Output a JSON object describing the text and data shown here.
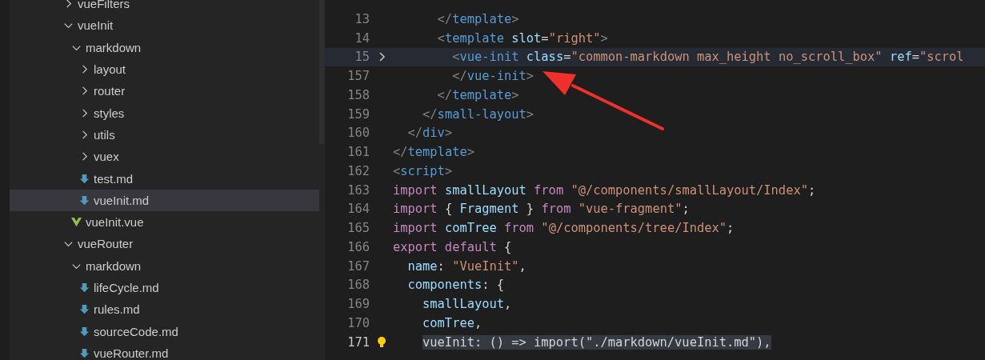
{
  "explorer": {
    "items": [
      {
        "name": "vueFilters",
        "kind": "folder",
        "expanded": false,
        "selected": false
      },
      {
        "name": "vueInit",
        "kind": "folder",
        "expanded": true,
        "selected": false,
        "children": [
          {
            "name": "markdown",
            "kind": "folder",
            "expanded": true,
            "selected": false,
            "children": [
              {
                "name": "layout",
                "kind": "folder",
                "expanded": false,
                "selected": false
              },
              {
                "name": "router",
                "kind": "folder",
                "expanded": false,
                "selected": false
              },
              {
                "name": "styles",
                "kind": "folder",
                "expanded": false,
                "selected": false
              },
              {
                "name": "utils",
                "kind": "folder",
                "expanded": false,
                "selected": false
              },
              {
                "name": "vuex",
                "kind": "folder",
                "expanded": false,
                "selected": false
              },
              {
                "name": "test.md",
                "kind": "md",
                "selected": false
              },
              {
                "name": "vueInit.md",
                "kind": "md",
                "selected": true
              }
            ]
          },
          {
            "name": "vueInit.vue",
            "kind": "vue",
            "selected": false
          }
        ]
      },
      {
        "name": "vueRouter",
        "kind": "folder",
        "expanded": true,
        "selected": false,
        "children": [
          {
            "name": "markdown",
            "kind": "folder",
            "expanded": true,
            "selected": false,
            "children": [
              {
                "name": "lifeCycle.md",
                "kind": "md",
                "selected": false
              },
              {
                "name": "rules.md",
                "kind": "md",
                "selected": false
              },
              {
                "name": "sourceCode.md",
                "kind": "md",
                "selected": false
              },
              {
                "name": "vueRouter.md",
                "kind": "md",
                "selected": false
              }
            ]
          }
        ]
      }
    ]
  },
  "editor": {
    "lines": [
      {
        "number": "13",
        "folded": false,
        "current": false,
        "lightbulb": false,
        "tokens": [
          {
            "kind": "punct",
            "text": "      </"
          },
          {
            "kind": "tag",
            "text": "template"
          },
          {
            "kind": "punct",
            "text": ">"
          }
        ]
      },
      {
        "number": "14",
        "folded": false,
        "current": false,
        "lightbulb": false,
        "tokens": [
          {
            "kind": "punct",
            "text": "      <"
          },
          {
            "kind": "tag",
            "text": "template"
          },
          {
            "kind": "attr",
            "text": " slot"
          },
          {
            "kind": "plain",
            "text": "="
          },
          {
            "kind": "str",
            "text": "\"right\""
          },
          {
            "kind": "punct",
            "text": ">"
          }
        ]
      },
      {
        "number": "15",
        "folded": true,
        "current": false,
        "lightbulb": false,
        "tokens": [
          {
            "kind": "punct",
            "text": "        <"
          },
          {
            "kind": "tag",
            "text": "vue-init"
          },
          {
            "kind": "attr",
            "text": " class"
          },
          {
            "kind": "plain",
            "text": "="
          },
          {
            "kind": "str",
            "text": "\"common-markdown max_height no_scroll_box\""
          },
          {
            "kind": "attr",
            "text": " ref"
          },
          {
            "kind": "plain",
            "text": "="
          },
          {
            "kind": "str",
            "text": "\"scrol"
          }
        ]
      },
      {
        "number": "157",
        "folded": false,
        "current": false,
        "lightbulb": false,
        "tokens": [
          {
            "kind": "punct",
            "text": "        </"
          },
          {
            "kind": "tag",
            "text": "vue-init"
          },
          {
            "kind": "punct",
            "text": ">"
          }
        ]
      },
      {
        "number": "158",
        "folded": false,
        "current": false,
        "lightbulb": false,
        "tokens": [
          {
            "kind": "punct",
            "text": "      </"
          },
          {
            "kind": "tag",
            "text": "template"
          },
          {
            "kind": "punct",
            "text": ">"
          }
        ]
      },
      {
        "number": "159",
        "folded": false,
        "current": false,
        "lightbulb": false,
        "tokens": [
          {
            "kind": "punct",
            "text": "    </"
          },
          {
            "kind": "tag",
            "text": "small-layout"
          },
          {
            "kind": "punct",
            "text": ">"
          }
        ]
      },
      {
        "number": "160",
        "folded": false,
        "current": false,
        "lightbulb": false,
        "tokens": [
          {
            "kind": "punct",
            "text": "  </"
          },
          {
            "kind": "tag",
            "text": "div"
          },
          {
            "kind": "punct",
            "text": ">"
          }
        ]
      },
      {
        "number": "161",
        "folded": false,
        "current": false,
        "lightbulb": false,
        "tokens": [
          {
            "kind": "punct",
            "text": "</"
          },
          {
            "kind": "tag",
            "text": "template"
          },
          {
            "kind": "punct",
            "text": ">"
          }
        ]
      },
      {
        "number": "162",
        "folded": false,
        "current": false,
        "lightbulb": false,
        "tokens": [
          {
            "kind": "punct",
            "text": "<"
          },
          {
            "kind": "tag",
            "text": "script"
          },
          {
            "kind": "punct",
            "text": ">"
          }
        ]
      },
      {
        "number": "163",
        "folded": false,
        "current": false,
        "lightbulb": false,
        "tokens": [
          {
            "kind": "kw",
            "text": "import"
          },
          {
            "kind": "var",
            "text": " smallLayout"
          },
          {
            "kind": "kw",
            "text": " from"
          },
          {
            "kind": "str",
            "text": " \"@/components/smallLayout/Index\""
          },
          {
            "kind": "plain",
            "text": ";"
          }
        ]
      },
      {
        "number": "164",
        "folded": false,
        "current": false,
        "lightbulb": false,
        "tokens": [
          {
            "kind": "kw",
            "text": "import"
          },
          {
            "kind": "plain",
            "text": " { "
          },
          {
            "kind": "var",
            "text": "Fragment"
          },
          {
            "kind": "plain",
            "text": " }"
          },
          {
            "kind": "kw",
            "text": " from"
          },
          {
            "kind": "str",
            "text": " \"vue-fragment\""
          },
          {
            "kind": "plain",
            "text": ";"
          }
        ]
      },
      {
        "number": "165",
        "folded": false,
        "current": false,
        "lightbulb": false,
        "tokens": [
          {
            "kind": "kw",
            "text": "import"
          },
          {
            "kind": "var",
            "text": " comTree"
          },
          {
            "kind": "kw",
            "text": " from"
          },
          {
            "kind": "str",
            "text": " \"@/components/tree/Index\""
          },
          {
            "kind": "plain",
            "text": ";"
          }
        ]
      },
      {
        "number": "166",
        "folded": false,
        "current": false,
        "lightbulb": false,
        "tokens": [
          {
            "kind": "kw",
            "text": "export default"
          },
          {
            "kind": "plain",
            "text": " {"
          }
        ]
      },
      {
        "number": "167",
        "folded": false,
        "current": false,
        "lightbulb": false,
        "tokens": [
          {
            "kind": "var",
            "text": "  name"
          },
          {
            "kind": "plain",
            "text": ": "
          },
          {
            "kind": "str",
            "text": "\"VueInit\""
          },
          {
            "kind": "plain",
            "text": ","
          }
        ]
      },
      {
        "number": "168",
        "folded": false,
        "current": false,
        "lightbulb": false,
        "tokens": [
          {
            "kind": "var",
            "text": "  components"
          },
          {
            "kind": "plain",
            "text": ": {"
          }
        ]
      },
      {
        "number": "169",
        "folded": false,
        "current": false,
        "lightbulb": false,
        "tokens": [
          {
            "kind": "var",
            "text": "    smallLayout"
          },
          {
            "kind": "plain",
            "text": ","
          }
        ]
      },
      {
        "number": "170",
        "folded": false,
        "current": false,
        "lightbulb": false,
        "tokens": [
          {
            "kind": "var",
            "text": "    comTree"
          },
          {
            "kind": "plain",
            "text": ","
          }
        ]
      },
      {
        "number": "171",
        "folded": false,
        "current": true,
        "lightbulb": true,
        "tokens": [
          {
            "kind": "sel",
            "text": "vueInit: () => import(\"./markdown/vueInit.md\"),"
          }
        ]
      }
    ]
  }
}
